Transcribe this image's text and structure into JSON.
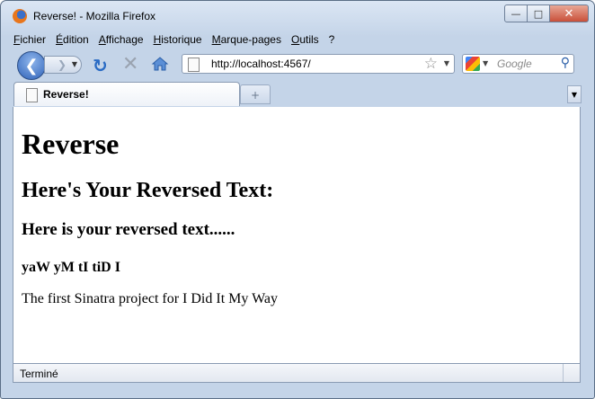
{
  "window": {
    "title": "Reverse! - Mozilla Firefox"
  },
  "menu": {
    "items": [
      "Fichier",
      "Édition",
      "Affichage",
      "Historique",
      "Marque-pages",
      "Outils",
      "?"
    ]
  },
  "nav": {
    "url": "http://localhost:4567/",
    "search_placeholder": "Google"
  },
  "tabs": {
    "active_label": "Reverse!",
    "new_tab_symbol": "+"
  },
  "page": {
    "h1": "Reverse",
    "h2": "Here's Your Reversed Text:",
    "h3": "Here is your reversed text......",
    "h4": "yaW yM tI tiD I",
    "paragraph": "The first Sinatra project for I Did It My Way"
  },
  "status": {
    "text": "Terminé"
  },
  "icons": {
    "back": "back-arrow-icon",
    "forward": "forward-arrow-icon",
    "reload": "reload-icon",
    "stop": "stop-icon",
    "home": "home-icon",
    "bookmark": "star-icon",
    "search": "magnifier-icon"
  }
}
